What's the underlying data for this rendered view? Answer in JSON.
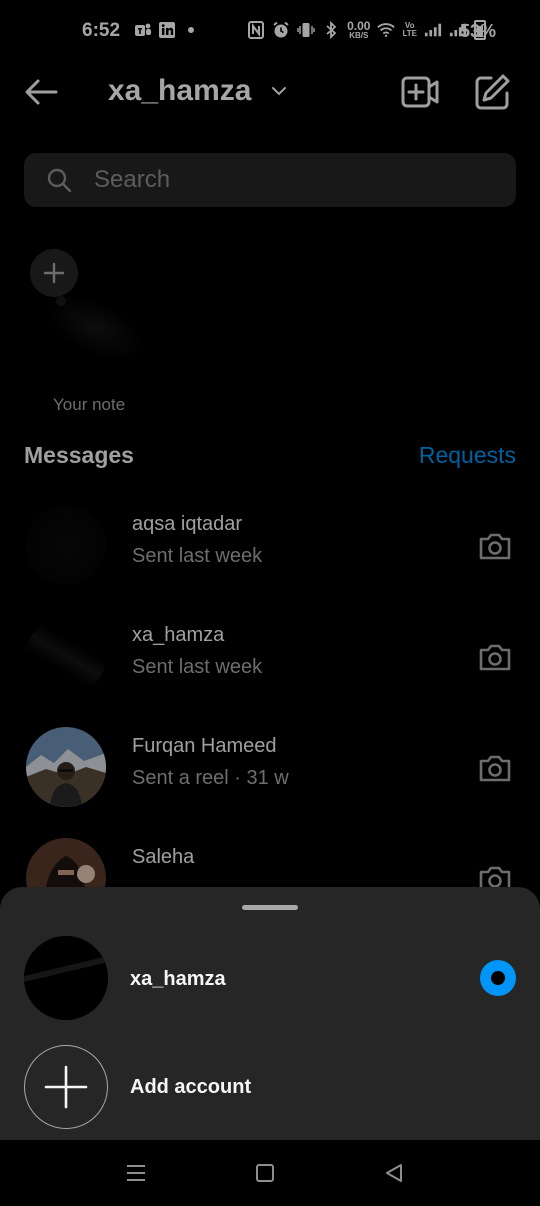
{
  "status_bar": {
    "time": "6:52",
    "net_speed_value": "0.00",
    "net_speed_unit": "KB/S",
    "volte_top": "Vo",
    "volte_bottom": "LTE",
    "battery": "53%"
  },
  "header": {
    "account": "xa_hamza"
  },
  "search": {
    "placeholder": "Search"
  },
  "notes": {
    "your_note_label": "Your note"
  },
  "messages": {
    "title": "Messages",
    "requests": "Requests",
    "conversations": [
      {
        "name": "aqsa iqtadar",
        "subtitle": "Sent last week"
      },
      {
        "name": "xa_hamza",
        "subtitle": "Sent last week"
      },
      {
        "name": "Furqan Hameed",
        "subtitle": "Sent a reel · 31 w"
      },
      {
        "name": "Saleha",
        "subtitle": ""
      }
    ]
  },
  "sheet": {
    "accounts": [
      {
        "name": "xa_hamza",
        "selected": true
      }
    ],
    "add_account": "Add account"
  },
  "colors": {
    "background": "#000000",
    "surface": "#262626",
    "accent": "#0095f6",
    "muted_text": "#a8a8a8"
  }
}
